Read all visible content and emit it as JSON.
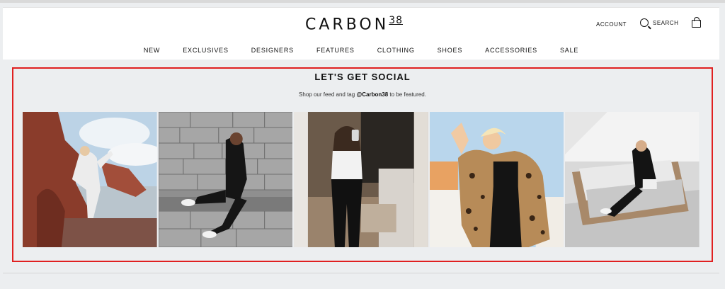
{
  "header": {
    "logo_text": "CARBON",
    "logo_number": "38",
    "account_label": "ACCOUNT",
    "search_label": "SEARCH"
  },
  "nav": [
    "NEW",
    "EXCLUSIVES",
    "DESIGNERS",
    "FEATURES",
    "CLOTHING",
    "SHOES",
    "ACCESSORIES",
    "SALE"
  ],
  "social": {
    "title": "LET'S GET SOCIAL",
    "subtitle_pre": "Shop our feed and tag ",
    "subtitle_handle": "@Carbon38",
    "subtitle_post": " to be featured."
  },
  "gallery": {
    "tiles": [
      "photo-rocks-yoga",
      "photo-stone-wall",
      "photo-mirror-selfie",
      "photo-leopard-coat",
      "photo-patio-lounge"
    ]
  },
  "colors": {
    "highlight_border": "#e02020",
    "page_background": "#eceef0"
  }
}
